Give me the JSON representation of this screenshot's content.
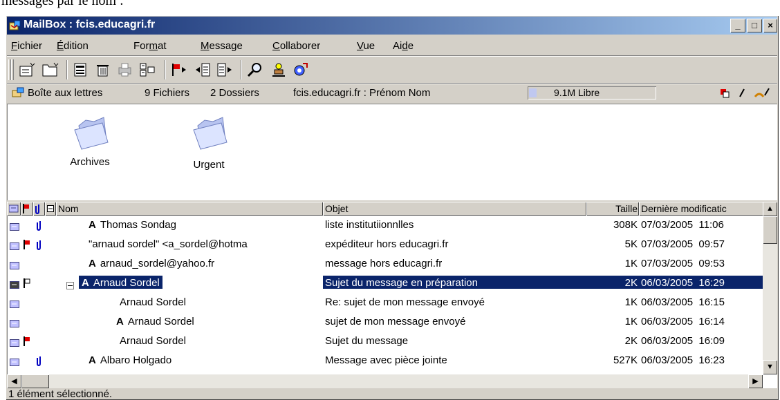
{
  "above_text": "messages par le nom :",
  "window": {
    "title": "MailBox : fcis.educagri.fr",
    "controls": {
      "minimize": "_",
      "maximize": "□",
      "close": "×"
    }
  },
  "menu": [
    {
      "ul": "F",
      "rest": "ichier"
    },
    {
      "ul": "É",
      "rest": "dition"
    },
    {
      "pre": "For",
      "ul": "m",
      "rest": "at"
    },
    {
      "ul": "M",
      "rest": "essage"
    },
    {
      "ul": "C",
      "rest": "ollaborer"
    },
    {
      "ul": "V",
      "rest": "ue"
    },
    {
      "pre": "Ai",
      "ul": "d",
      "rest": "e"
    }
  ],
  "toolbar": {
    "tools": [
      "new-message-icon",
      "new-folder-icon",
      "compose-icon",
      "delete-icon",
      "print-icon",
      "view-icon",
      "flag-icon",
      "reply-icon",
      "forward-icon",
      "search-icon",
      "user-icon",
      "send-receive-icon"
    ]
  },
  "infobar": {
    "mailbox": "Boîte aux lettres",
    "files": "9 Fichiers",
    "folders": "2 Dossiers",
    "account": "fcis.educagri.fr : Prénom Nom",
    "free": "9.1M Libre",
    "free_fraction": 0.06
  },
  "folders": [
    {
      "name": "Archives"
    },
    {
      "name": "Urgent"
    }
  ],
  "columns": {
    "name": "Nom",
    "subject": "Objet",
    "size": "Taille",
    "modified": "Dernière modificatic"
  },
  "messages": [
    {
      "author_mark": "A",
      "name": "Thomas Sondag",
      "subject": "liste institutiionnlles",
      "size": "308K",
      "date": "07/03/2005  11:06",
      "flag": "",
      "attach": true,
      "indent": 0,
      "selected": false
    },
    {
      "author_mark": "",
      "name": "\"arnaud sordel\" <a_sordel@hotma",
      "subject": "expéditeur hors educagri.fr",
      "size": "5K",
      "date": "07/03/2005  09:57",
      "flag": "red",
      "attach": true,
      "indent": 0,
      "selected": false
    },
    {
      "author_mark": "A",
      "name": "arnaud_sordel@yahoo.fr",
      "subject": "message hors educagri.fr",
      "size": "1K",
      "date": "07/03/2005  09:53",
      "flag": "",
      "attach": false,
      "indent": 0,
      "selected": false
    },
    {
      "author_mark": "A",
      "name": "Arnaud Sordel",
      "subject": "Sujet du message en préparation",
      "size": "2K",
      "date": "06/03/2005  16:29",
      "flag": "outline",
      "attach": false,
      "indent": 0,
      "selected": true,
      "expander": "⊟"
    },
    {
      "author_mark": "",
      "name": "Arnaud Sordel",
      "subject": "Re: sujet de mon message envoyé",
      "size": "1K",
      "date": "06/03/2005  16:15",
      "flag": "",
      "attach": false,
      "indent": 2,
      "selected": false
    },
    {
      "author_mark": "A",
      "name": "Arnaud Sordel",
      "subject": "sujet de mon message envoyé",
      "size": "1K",
      "date": "06/03/2005  16:14",
      "flag": "",
      "attach": false,
      "indent": 1,
      "selected": false
    },
    {
      "author_mark": "",
      "name": "Arnaud Sordel",
      "subject": "Sujet du message",
      "size": "2K",
      "date": "06/03/2005  16:09",
      "flag": "red",
      "attach": false,
      "indent": 2,
      "selected": false
    },
    {
      "author_mark": "A",
      "name": "Albaro Holgado",
      "subject": "Message avec pièce jointe",
      "size": "527K",
      "date": "06/03/2005  16:23",
      "flag": "",
      "attach": true,
      "indent": 0,
      "selected": false
    }
  ],
  "status": "1 élément sélectionné.",
  "colors": {
    "selection": "#0a246a",
    "flag": "#e00000",
    "attach": "#0000c0",
    "title_start": "#0a246a",
    "title_end": "#a6caf0"
  }
}
